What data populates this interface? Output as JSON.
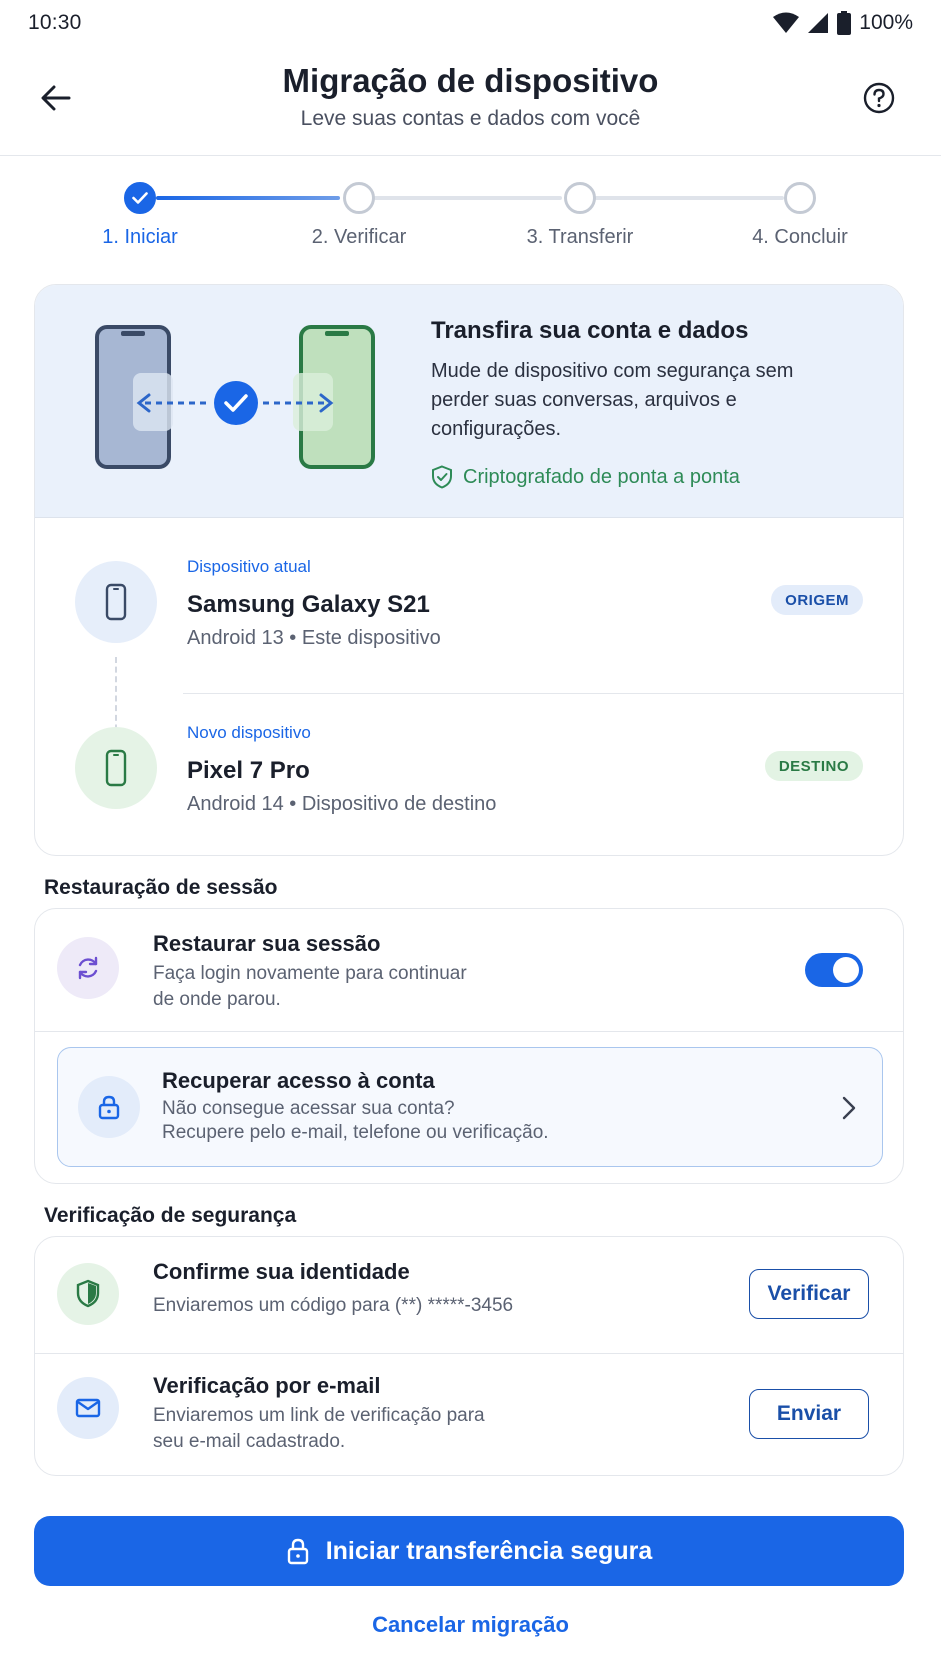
{
  "status_bar": {
    "time": "10:30",
    "battery": "100%"
  },
  "header": {
    "title": "Migração de dispositivo",
    "subtitle": "Leve suas contas e dados com você"
  },
  "stepper": {
    "steps": [
      {
        "label": "1. Iniciar",
        "state": "done"
      },
      {
        "label": "2. Verificar",
        "state": "pending"
      },
      {
        "label": "3. Transferir",
        "state": "pending"
      },
      {
        "label": "4. Concluir",
        "state": "pending"
      }
    ]
  },
  "hero": {
    "title": "Transfira sua conta e dados",
    "description": "Mude de dispositivo com segurança sem perder suas conversas, arquivos e configurações.",
    "encryption": "Criptografado de ponta a ponta"
  },
  "devices": {
    "current": {
      "kicker": "Dispositivo atual",
      "name": "Samsung Galaxy S21",
      "meta": "Android 13 • Este dispositivo",
      "badge": "ORIGEM"
    },
    "new": {
      "kicker": "Novo dispositivo",
      "name": "Pixel 7 Pro",
      "meta": "Android 14 • Dispositivo de destino",
      "badge": "DESTINO"
    }
  },
  "session": {
    "section_title": "Restauração de sessão",
    "restore_title": "Restaurar sua sessão",
    "restore_desc_1": "Faça login novamente para continuar",
    "restore_desc_2": "de onde parou.",
    "restore_enabled": true,
    "recover_title": "Recuperar acesso à conta",
    "recover_desc_1": "Não consegue acessar sua conta?",
    "recover_desc_2": "Recupere pelo e-mail, telefone ou verificação."
  },
  "security": {
    "section_title": "Verificação de segurança",
    "identity_title": "Confirme sua identidade",
    "identity_desc": "Enviaremos um código para (**) *****-3456",
    "identity_button": "Verificar",
    "email_title": "Verificação por e-mail",
    "email_desc_1": "Enviaremos um link de verificação para",
    "email_desc_2": "seu e-mail cadastrado.",
    "email_button": "Enviar"
  },
  "actions": {
    "primary": "Iniciar transferência segura",
    "cancel": "Cancelar migração"
  },
  "colors": {
    "primary": "#1a66e6",
    "success": "#2e8b57",
    "hero_bg": "#eaf1fb"
  }
}
